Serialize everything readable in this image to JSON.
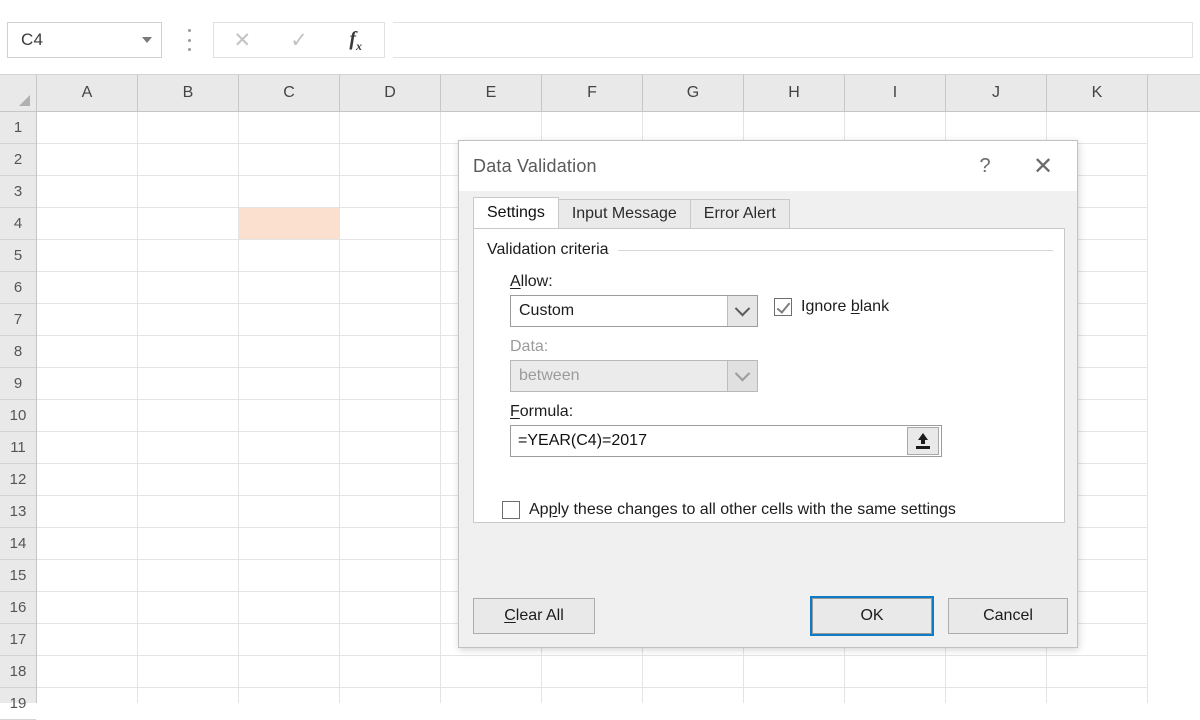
{
  "formula_bar": {
    "name_box_value": "C4",
    "name_box_icon": "chevron-down-icon",
    "cancel_icon": "close-x-icon",
    "confirm_icon": "check-icon",
    "function_icon": "fx-insert-function-icon",
    "formula_value": ""
  },
  "grid": {
    "columns": [
      "A",
      "B",
      "C",
      "D",
      "E",
      "F",
      "G",
      "H",
      "I",
      "J",
      "K"
    ],
    "rows": [
      "1",
      "2",
      "3",
      "4",
      "5",
      "6",
      "7",
      "8",
      "9",
      "10",
      "11",
      "12",
      "13",
      "14",
      "15",
      "16",
      "17",
      "18",
      "19"
    ],
    "selected_cell": "C4",
    "highlighted_cell_color": "#fbe0d0",
    "select_all_icon": "select-all-triangle-icon"
  },
  "dialog": {
    "title": "Data Validation",
    "help_label": "?",
    "close_label": "✕",
    "help_icon": "question-mark-icon",
    "close_icon": "close-x-icon",
    "tabs": [
      {
        "label": "Settings",
        "active": true
      },
      {
        "label": "Input Message",
        "active": false
      },
      {
        "label": "Error Alert",
        "active": false
      }
    ],
    "group_label": "Validation criteria",
    "allow": {
      "label_prefix": "",
      "label_accel": "A",
      "label_rest": "llow:",
      "value": "Custom",
      "chevron_icon": "chevron-down-icon",
      "enabled": true
    },
    "ignore_blank": {
      "label_prefix": "Ignore ",
      "label_accel": "b",
      "label_rest": "lank",
      "checked": true
    },
    "data": {
      "label_prefix": "Data:",
      "label_accel": "",
      "label_rest": "",
      "value": "between",
      "chevron_icon": "chevron-down-icon",
      "enabled": false
    },
    "formula": {
      "label_prefix": "",
      "label_accel": "F",
      "label_rest": "ormula:",
      "value": "=YEAR(C4)=2017",
      "picker_icon": "range-selector-icon"
    },
    "apply_all": {
      "label_prefix": "Ap",
      "label_accel": "p",
      "label_rest": "ly these changes to all other cells with the same settings",
      "checked": false
    },
    "buttons": {
      "clear_all": {
        "prefix": "",
        "accel": "C",
        "rest": "lear All"
      },
      "ok": {
        "label": "OK",
        "is_default": true
      },
      "cancel": {
        "label": "Cancel",
        "is_default": false
      }
    },
    "accent_color": "#0f7bc4"
  }
}
